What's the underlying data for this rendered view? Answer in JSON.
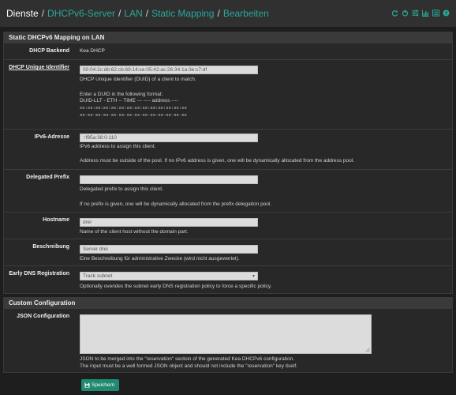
{
  "breadcrumb": {
    "root": "Dienste",
    "items": [
      "DHCPv6-Server",
      "LAN",
      "Static Mapping",
      "Bearbeiten"
    ],
    "separator": "/"
  },
  "toolbar_icons": [
    "reload-icon",
    "power-icon",
    "sliders-icon",
    "chart-icon",
    "list-icon",
    "help-icon"
  ],
  "panel_static": {
    "title": "Static DHCPv6 Mapping on LAN",
    "dhcp_backend": {
      "label": "DHCP Backend",
      "value": "Kea DHCP"
    },
    "duid": {
      "label": "DHCP Unique Identifier",
      "value": "00:04:2c:db:62:cb:69:14:ce:05:42:ac:26:34:1a:3e:c7:df",
      "help1": "DHCP Unique Identifier (DUID) of a client to match.",
      "help2": "Enter a DUID in the following format:",
      "help3": "DUID-LLT - ETH -- TIME --- ---- address ----",
      "help4": "xx:xx:xx:xx:xx:xx:xx:xx:xx:xx:xx:xx:xx:xx",
      "help5": "xx-xx-xx-xx-xx-xx-xx-xx-xx-xx-xx-xx-xx-xx"
    },
    "ipv6": {
      "label": "IPv6-Adresse",
      "value": "::f95a:38:0:110",
      "help1": "IPv6 address to assign this client.",
      "help2": "Address must be outside of the pool. If no IPv6 address is given, one will be dynamically allocated from the address pool."
    },
    "delegated": {
      "label": "Delegated Prefix",
      "value": "",
      "help1": "Delegated prefix to assign this client.",
      "help2": "If no prefix is given, one will be dynamically allocated from the prefix delegation pool."
    },
    "hostname": {
      "label": "Hostname",
      "value": "drei",
      "help": "Name of the client host without the domain part."
    },
    "description": {
      "label": "Beschreibung",
      "value": "Server drei",
      "help": "Eine Beschreibung für administrative Zwecke (wird nicht ausgewertet)."
    },
    "early_dns": {
      "label": "Early DNS Registration",
      "value": "Track subnet",
      "help": "Optionally overides the subnet early DNS registration policy to force a specific policy."
    }
  },
  "panel_custom": {
    "title": "Custom Configuration",
    "json": {
      "label": "JSON Configuration",
      "value": "",
      "help1": "JSON to be merged into the \"reservation\" section of the generated Kea DHCPv6 configuration.",
      "help2": "The input must be a well formed JSON object and should not include the \"reservation\" key itself."
    }
  },
  "save_label": "Speichern",
  "colors": {
    "accent": "#2aa89b",
    "button": "#1f8a70",
    "panel": "#282828",
    "header": "#3a3a3a"
  }
}
